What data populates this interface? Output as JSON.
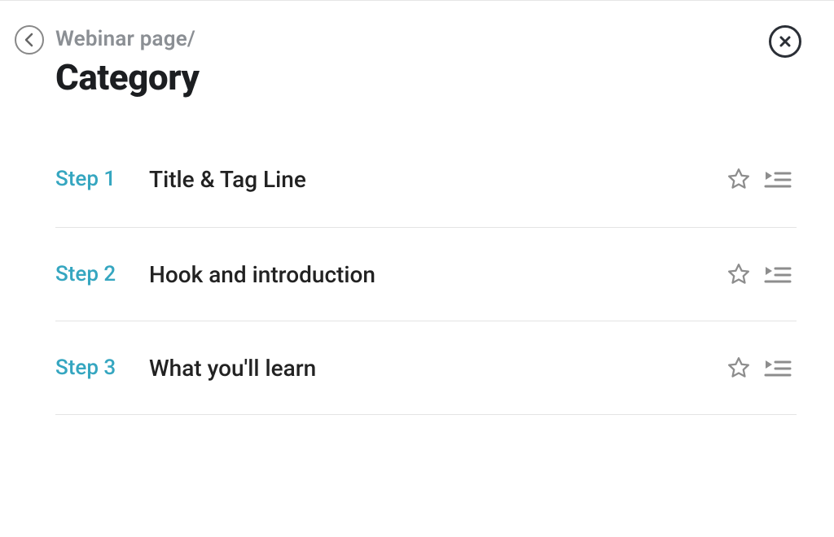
{
  "breadcrumb": "Webinar page/",
  "title": "Category",
  "steps": [
    {
      "label": "Step 1",
      "title": "Title & Tag Line"
    },
    {
      "label": "Step 2",
      "title": "Hook and introduction"
    },
    {
      "label": "Step 3",
      "title": "What you'll learn"
    }
  ],
  "colors": {
    "accent": "#35a6c0",
    "text": "#222",
    "muted": "#8b8f94",
    "icon": "#8d8d8d",
    "border": "#e4e4e4"
  }
}
